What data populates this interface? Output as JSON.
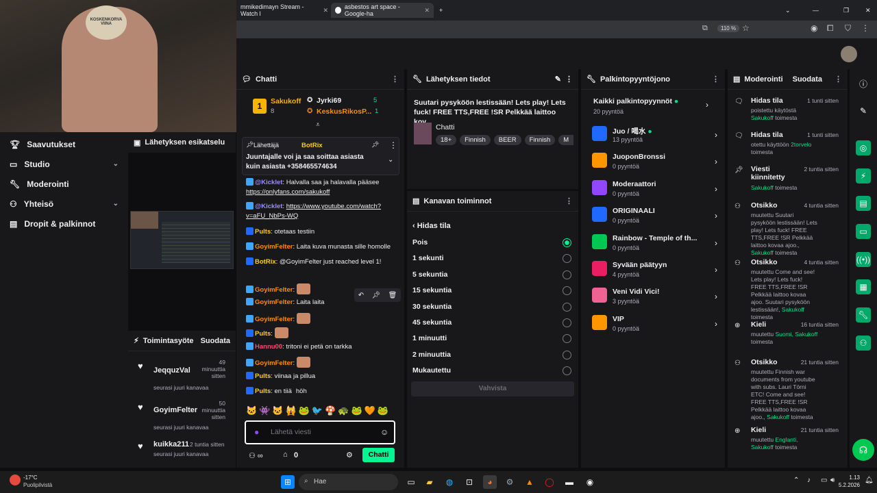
{
  "browser": {
    "tabs": [
      "mmikedimayn Stream - Watch l",
      "asbestos art space - Google-ha"
    ],
    "zoom": "110 %"
  },
  "cam": {
    "sign": "KOSKENKORVA VIINA"
  },
  "nav": {
    "items": [
      {
        "label": "Saavutukset",
        "icon": "trophy-icon"
      },
      {
        "label": "Studio",
        "icon": "studio-icon"
      },
      {
        "label": "Moderointi",
        "icon": "wrench-icon"
      },
      {
        "label": "Yhteisö",
        "icon": "community-icon"
      },
      {
        "label": "Dropit & palkinnot",
        "icon": "drops-icon"
      }
    ]
  },
  "preview": {
    "title": "Lähetyksen esikatselu"
  },
  "activity": {
    "title": "Toimintasyöte",
    "action": "Suodata",
    "items": [
      {
        "user": "JeqquzVal",
        "time": "49 minuuttia sitten",
        "desc": "seurasi juuri kanavaa"
      },
      {
        "user": "GoyimFelter",
        "time": "50 minuuttia sitten",
        "desc": "seurasi juuri kanavaa"
      },
      {
        "user": "kuikka211",
        "time": "2 tuntia sitten",
        "desc": "seurasi juuri kanavaa"
      }
    ]
  },
  "chat": {
    "title": "Chatti",
    "leaders": [
      {
        "name": "Sakukoff",
        "score": "8"
      },
      {
        "name": "Jyrki69",
        "score": "5"
      },
      {
        "name": "KeskusRikosP...",
        "score": "1"
      }
    ],
    "rank": "1",
    "pinned": {
      "label": "Lähettäjä",
      "user": "BotRix",
      "text": "Juuntajalle voi ja saa soittaa asiasta kuin asiasta +358465574634"
    },
    "messages": [
      {
        "user": "@Kicklet",
        "color": "#9b8cff",
        "text": "Halvalla saa ja halavalla pääsee ",
        "link": "https://onlyfans.com/sakukoff"
      },
      {
        "user": "@Kicklet",
        "color": "#9b8cff",
        "text": "",
        "link": "https://www.youtube.com/watch?v=aFU_NbPs-WQ"
      },
      {
        "user": "Pults",
        "color": "#ffd000",
        "text": "otetaas testiin"
      },
      {
        "user": "GoyimFelter",
        "color": "#ff8c00",
        "text": "Laita kuva munasta sille homolle"
      },
      {
        "user": "BotRix",
        "color": "#ffd000",
        "text": "@GoyimFelter just reached level 1!"
      },
      {
        "user": "GoyimFelter",
        "color": "#ff8c00",
        "text": ""
      },
      {
        "user": "GoyimFelter",
        "color": "#ff8c00",
        "text": "Laita laita"
      },
      {
        "user": "GoyimFelter",
        "color": "#ff8c00",
        "text": ""
      },
      {
        "user": "Pults",
        "color": "#ffd000",
        "text": ""
      },
      {
        "user": "Hannu00",
        "color": "#ff4a6e",
        "text": "tritoni ei petä on tarkka"
      },
      {
        "user": "GoyimFelter",
        "color": "#ff8c00",
        "text": ""
      },
      {
        "user": "Pults",
        "color": "#ffd000",
        "text": "viinaa ja pillua"
      },
      {
        "user": "Pults",
        "color": "#ffd000",
        "text": "en tiiä",
        "extra": "höh"
      }
    ],
    "placeholder": "Lähetä viesti",
    "send": "Chatti",
    "points": "0"
  },
  "stream": {
    "title": "Lähetyksen tiedot",
    "desc": "Suutari pysyköön lestissään! Lets play! Lets fuck! FREE TTS,FREE !SR Pelkkää laittoo kov...",
    "category": "Chatti",
    "tags": [
      "18+",
      "Finnish",
      "BEER",
      "Finnish",
      "M"
    ]
  },
  "actions": {
    "title": "Kanavan toiminnot",
    "back": "Hidas tila",
    "options": [
      "Pois",
      "1 sekunti",
      "5 sekuntia",
      "15 sekuntia",
      "30 sekuntia",
      "45 sekuntia",
      "1 minuutti",
      "2 minuuttia",
      "Mukautettu"
    ],
    "selected": 0,
    "confirm": "Vahvista"
  },
  "rewards": {
    "title": "Palkintopyyntöjono",
    "all": "Kaikki palkintopyynnöt",
    "all_count": "20 pyyntöä",
    "items": [
      {
        "name": "Juo / 喝水",
        "count": "13 pyyntöä",
        "color": "#1f69ff",
        "online": true
      },
      {
        "name": "JuoponBronssi",
        "count": "0 pyyntöä",
        "color": "#ff9600"
      },
      {
        "name": "Moderaattori",
        "count": "0 pyyntöä",
        "color": "#9147ff"
      },
      {
        "name": "ORIGINAALI",
        "count": "0 pyyntöä",
        "color": "#1f69ff"
      },
      {
        "name": "Rainbow - Temple of th...",
        "count": "0 pyyntöä",
        "color": "#00c853"
      },
      {
        "name": "Syvään päätyyn",
        "count": "4 pyyntöä",
        "color": "#e91e63"
      },
      {
        "name": "Veni Vidi Vici!",
        "count": "3 pyyntöä",
        "color": "#f06292"
      },
      {
        "name": "VIP",
        "count": "0 pyyntöä",
        "color": "#ff9600"
      }
    ]
  },
  "mod": {
    "title": "Moderointi",
    "filter": "Suodata",
    "items": [
      {
        "title": "Hidas tila",
        "time": "1 tunti sitten",
        "desc": "poistettu käytöstä ",
        "who": "Sakukoff",
        "tail": " toimesta"
      },
      {
        "title": "Hidas tila",
        "time": "1 tunti sitten",
        "desc": "otettu käyttöön ",
        "who": "2torvelo",
        "tail": " toimesta"
      },
      {
        "title": "Viesti kiinnitetty",
        "time": "2 tuntia sitten",
        "desc": "",
        "who": "Sakukoff",
        "tail": " toimesta"
      },
      {
        "title": "Otsikko",
        "time": "4 tuntia sitten",
        "desc": "muutettu Suutari pysyköön lestissään! Lets play! Lets fuck! FREE TTS,FREE !SR Pelkkää laittoo kovaa ajoo., ",
        "who": "Sakukoff",
        "tail": " toimesta"
      },
      {
        "title": "Otsikko",
        "time": "4 tuntia sitten",
        "desc": "muutettu Come and see! Lets play! Lets fuck! FREE TTS,FREE !SR Pelkkää laittoo kovaa ajoo. Suutari pysyköön lestissään!, ",
        "who": "Sakukoff",
        "tail": " toimesta"
      },
      {
        "title": "Kieli",
        "time": "16 tuntia sitten",
        "desc": "muutettu ",
        "who": "Suomi, Sakukoff",
        "tail": " toimesta"
      },
      {
        "title": "Otsikko",
        "time": "21 tuntia sitten",
        "desc": "muutettu Finnish war documents from youtube with subs. Lauri Törni ETC! Come and see! FREE TTS,FREE !SR Pelkkää laittoo kovaa ajoo., ",
        "who": "Sakukoff",
        "tail": " toimesta"
      },
      {
        "title": "Kieli",
        "time": "21 tuntia sitten",
        "desc": "muutettu ",
        "who": "Englanti, Sakukoff",
        "tail": " toimesta"
      }
    ]
  },
  "taskbar": {
    "temp": "-17°C",
    "weather": "Puolipilvistä",
    "search": "Hae",
    "time": "1.13",
    "date": "5.2.2026"
  }
}
